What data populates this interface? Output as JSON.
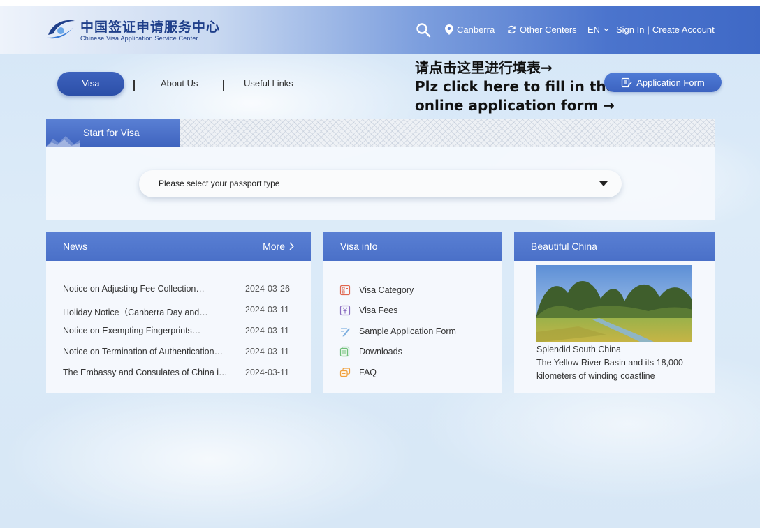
{
  "header": {
    "logo_cn": "中国签证申请服务中心",
    "logo_en": "Chinese Visa Application Service Center",
    "location": "Canberra",
    "other_centers": "Other Centers",
    "language": "EN",
    "sign_in": "Sign In",
    "create_account": "Create Account"
  },
  "tabs": {
    "visa": "Visa",
    "about": "About Us",
    "links": "Useful Links"
  },
  "promo": {
    "line1": "请点击这里进行填表→",
    "line2": "Plz click here to fill in the",
    "line3": "online application form →"
  },
  "application_form_label": "Application Form",
  "start": {
    "title": "Start for Visa",
    "passport_placeholder": "Please select your passport type"
  },
  "news": {
    "title": "News",
    "more": "More",
    "items": [
      {
        "title": "Notice on Adjusting Fee Collection…",
        "date": "2024-03-26"
      },
      {
        "title": "Holiday Notice（Canberra Day and…",
        "date": "2024-03-11"
      },
      {
        "title": "Notice on Exempting Fingerprints…",
        "date": "2024-03-11"
      },
      {
        "title": "Notice on Termination of Authentication…",
        "date": "2024-03-11"
      },
      {
        "title": "The Embassy and Consulates of China i…",
        "date": "2024-03-11"
      }
    ]
  },
  "visa_info": {
    "title": "Visa info",
    "items": [
      "Visa Category",
      "Visa Fees",
      "Sample Application Form",
      "Downloads",
      "FAQ"
    ]
  },
  "beautiful_china": {
    "title": "Beautiful China",
    "caption_title": "Splendid South China",
    "caption_text": "The Yellow River Basin and its 18,000 kilometers of winding coastline"
  },
  "colors": {
    "brand_blue": "#3f64bf",
    "header_dark": "#3f69c6",
    "icon_red": "#e0664f",
    "icon_purple": "#8a6cc0",
    "icon_green": "#6fbf7a",
    "icon_orange": "#f0a03c"
  }
}
